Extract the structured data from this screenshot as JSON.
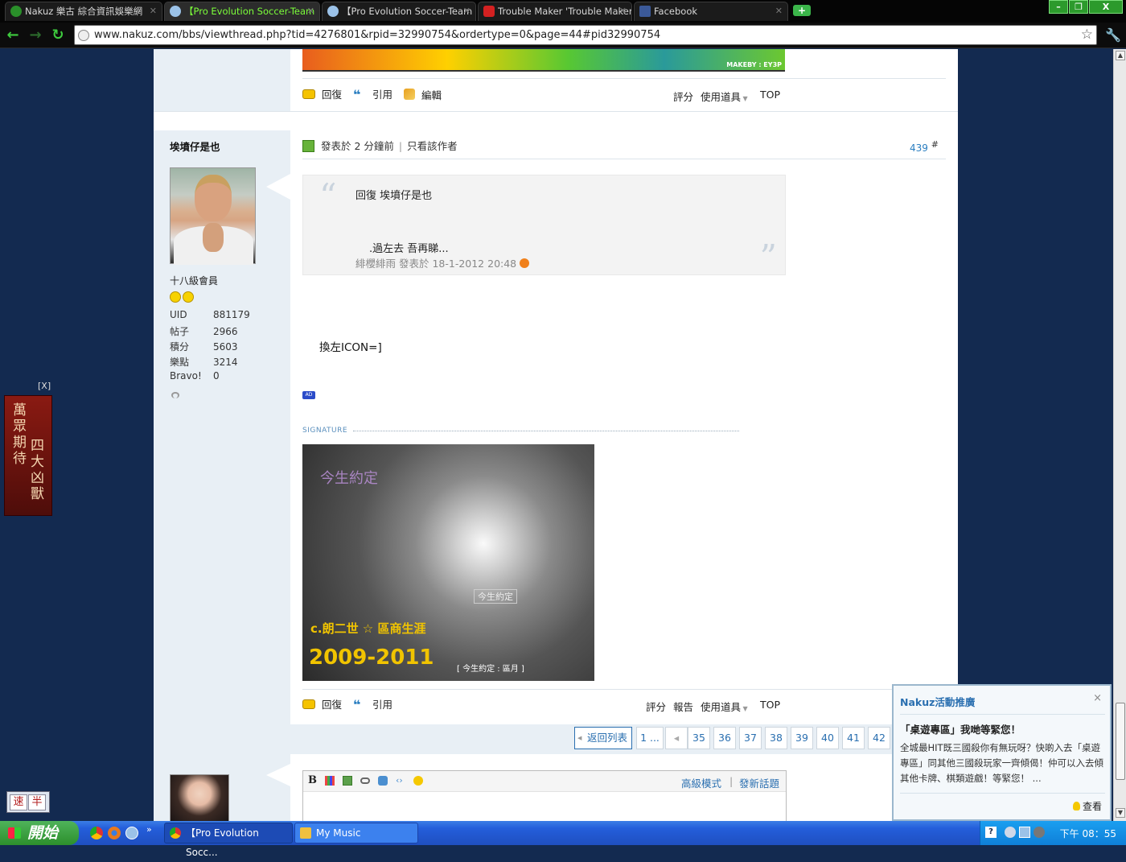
{
  "browser": {
    "tabs": [
      {
        "label": "Nakuz 樂古 綜合資訊娛樂網",
        "active": false
      },
      {
        "label": "【Pro Evolution Soccer-Team",
        "active": true
      },
      {
        "label": "【Pro Evolution Soccer-Team",
        "active": false
      },
      {
        "label": "Trouble Maker 'Trouble Maker'",
        "active": false
      },
      {
        "label": "Facebook",
        "active": false
      }
    ],
    "new_tab": "+",
    "window_buttons": [
      "–",
      "❐",
      "X"
    ],
    "url": "www.nakuz.com/bbs/viewthread.php?tid=4276801&rpid=32990754&ordertype=0&page=44#pid32990754"
  },
  "banner": {
    "credit": "MAKEBY : EY3P"
  },
  "prev_actions": {
    "reply": "回復",
    "quote": "引用",
    "edit": "編輯",
    "rate": "評分",
    "tools": "使用道具",
    "top": "TOP"
  },
  "post": {
    "author": "埃墳仔是也",
    "rank": "十八級會員",
    "stats": [
      {
        "label": "UID",
        "value": "881179"
      },
      {
        "label": "帖子",
        "value": "2966"
      },
      {
        "label": "積分",
        "value": "5603"
      },
      {
        "label": "樂點",
        "value": "3214"
      },
      {
        "label": "Bravo!",
        "value": "0"
      }
    ],
    "posted": "發表於 2 分鐘前",
    "only_author": "只看該作者",
    "floor": "439",
    "floor_mark": "#",
    "quote": {
      "title": "回復  埃墳仔是也",
      "body": ".過左去 吾再睇...",
      "meta": "緋櫻緋雨 發表於 18-1-2012 20:48"
    },
    "content": "換左ICON=]",
    "ad_badge": "AD",
    "signature_label": "SIGNATURE",
    "signature_image_text": {
      "line1": "今生約定",
      "line2": "c.朗二世 ☆ 區商生涯",
      "years": "2009-2011",
      "caption": "[ 今生約定 : 區月 ]",
      "caption2": "今生約定"
    }
  },
  "post_actions": {
    "reply": "回復",
    "quote": "引用",
    "rate": "評分",
    "report": "報告",
    "tools": "使用道具",
    "top": "TOP"
  },
  "pagination": {
    "back": "返回列表",
    "first": "1 ...",
    "pages": [
      "35",
      "36",
      "37",
      "38",
      "39",
      "40",
      "41",
      "42"
    ]
  },
  "editor": {
    "advanced": "高級模式",
    "new_topic": "發新話題"
  },
  "left_ad": {
    "close": "[X]",
    "col1": "萬眾期待",
    "col2": "四大凶獸"
  },
  "ime": {
    "a": "速",
    "b": "半"
  },
  "promo": {
    "header": "Nakuz活動推廣",
    "close": "×",
    "title": "「桌遊專區」我哋等緊您！",
    "text": "全城最HIT既三國殺你有無玩呀？快啲入去「桌遊專區」同其他三國殺玩家一齊傾偈！仲可以入去傾其他卡牌、棋類遊戲！等緊您！ ...",
    "view": "查看"
  },
  "taskbar": {
    "start": "開始",
    "buttons": [
      "【Pro Evolution Socc...",
      "My Music"
    ],
    "clock": "下午 08：55"
  }
}
